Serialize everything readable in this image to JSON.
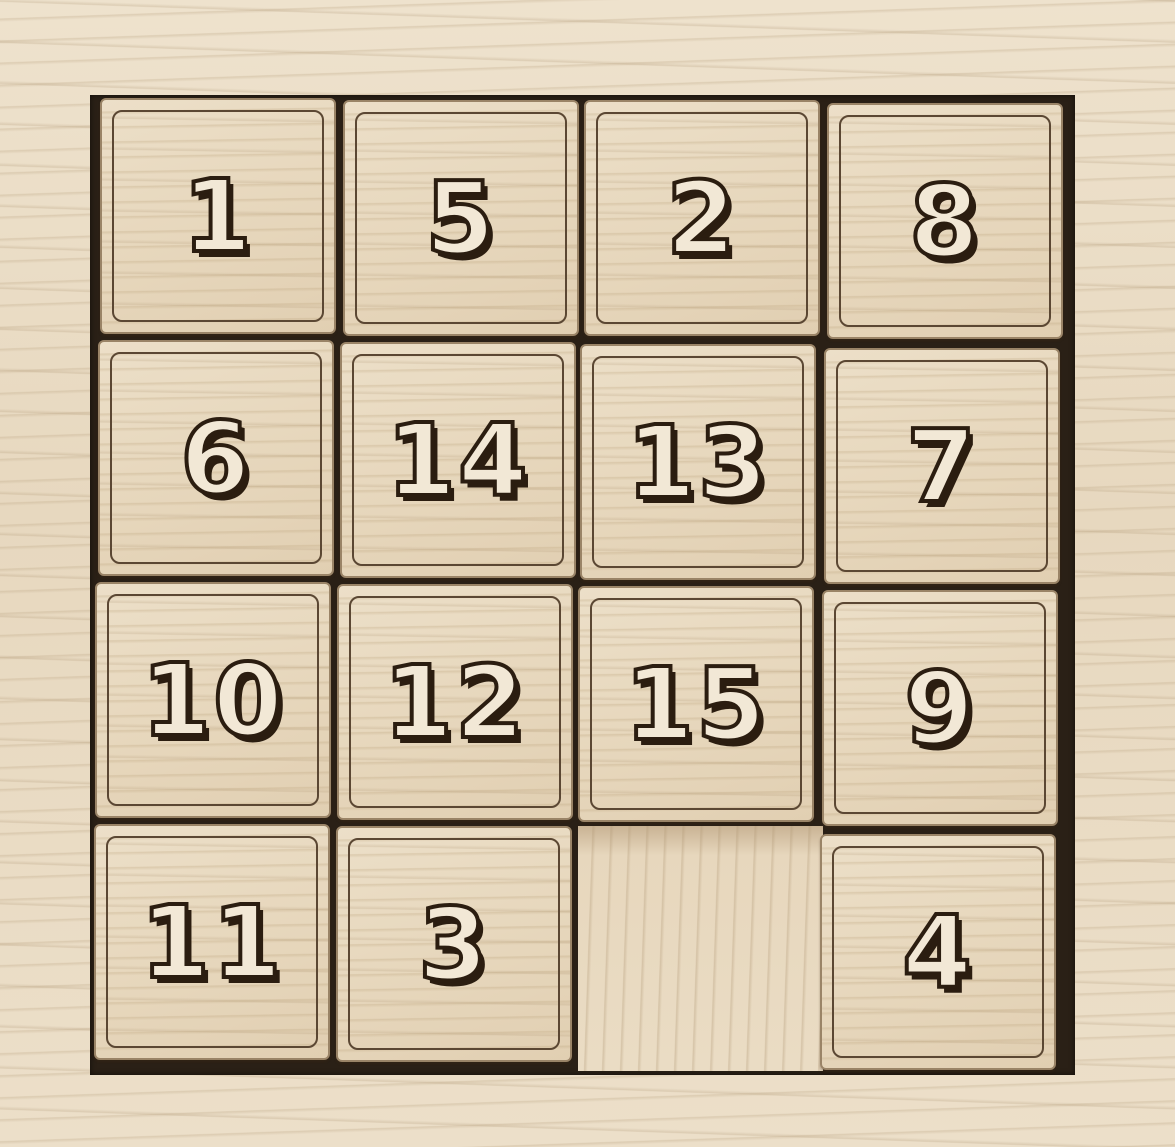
{
  "puzzle": {
    "rows": [
      [
        "1",
        "5",
        "2",
        "8"
      ],
      [
        "6",
        "14",
        "13",
        "7"
      ],
      [
        "10",
        "12",
        "15",
        "9"
      ],
      [
        "11",
        "3",
        "",
        "4"
      ]
    ]
  }
}
